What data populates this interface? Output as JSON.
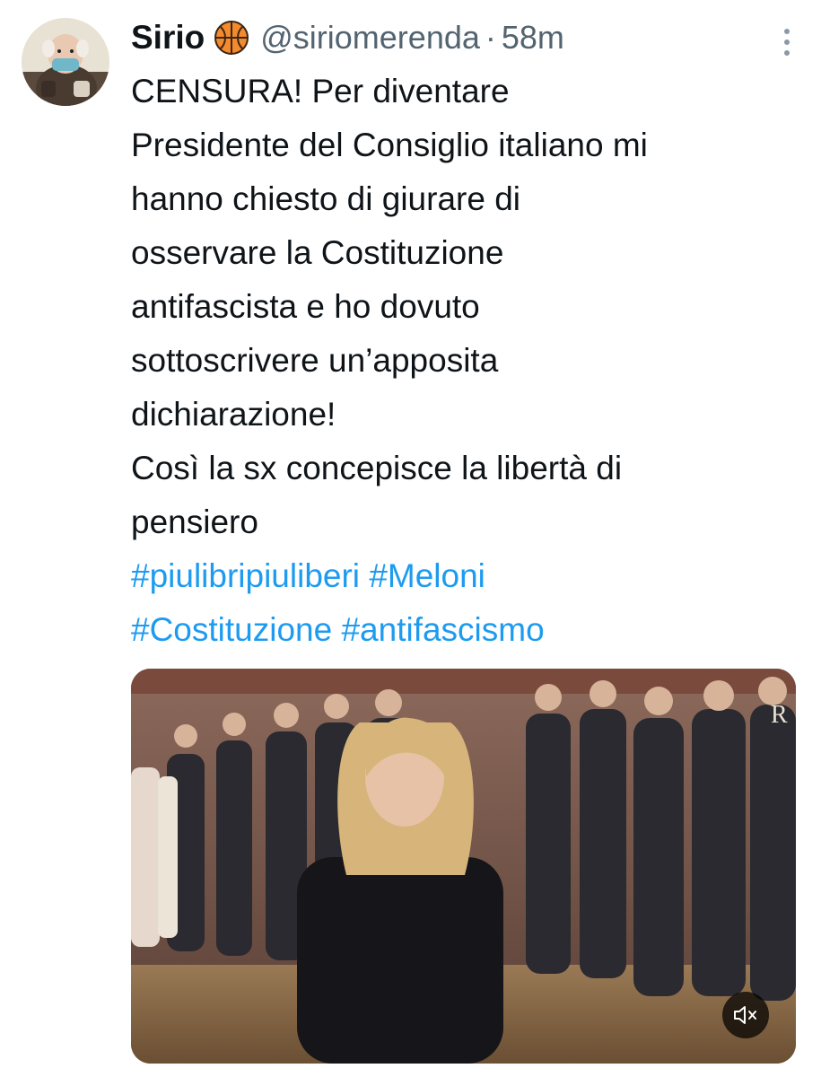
{
  "tweet": {
    "display_name": "Sirio",
    "badge_icon": "basketball-icon",
    "handle": "@siriomerenda",
    "separator": "·",
    "time": "58m",
    "text": "CENSURA! Per diventare\nPresidente del Consiglio italiano mi\nhanno chiesto di giurare di\nosservare la Costituzione\nantifascista e ho dovuto\nsottoscrivere un’apposita\ndichiarazione!\nCosì la sx concepisce la libertà di\npensiero",
    "hashtags": [
      "#piulibripiuliberi",
      "#Meloni",
      "#Costituzione",
      "#antifascismo"
    ],
    "more_icon": "more-vertical-icon"
  },
  "media": {
    "type": "video",
    "mute_icon": "volume-muted-icon"
  },
  "colors": {
    "link": "#1d9bf0",
    "secondary_text": "#536471",
    "primary_text": "#0f1419",
    "background": "#ffffff"
  }
}
